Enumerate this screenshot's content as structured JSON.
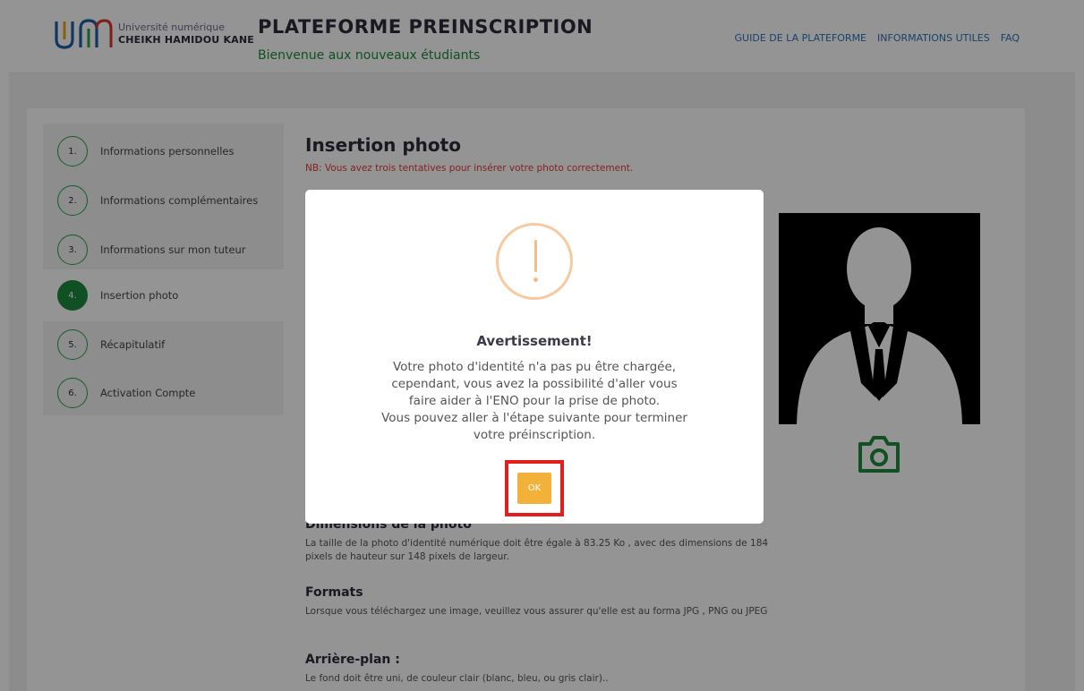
{
  "header": {
    "logo_line1": "Université numérique",
    "logo_line2": "CHEIKH HAMIDOU KANE",
    "title": "PLATEFORME PREINSCRIPTION",
    "subtitle": "Bienvenue aux nouveaux étudiants",
    "nav": [
      "GUIDE DE LA PLATEFORME",
      "INFORMATIONS UTILES",
      "FAQ"
    ]
  },
  "steps": [
    {
      "num": "1.",
      "label": "Informations personnelles"
    },
    {
      "num": "2.",
      "label": "Informations complémentaires"
    },
    {
      "num": "3.",
      "label": "Informations sur mon tuteur"
    },
    {
      "num": "4.",
      "label": "Insertion photo",
      "active": true
    },
    {
      "num": "5.",
      "label": "Récapitulatif"
    },
    {
      "num": "6.",
      "label": "Activation Compte"
    }
  ],
  "main": {
    "title": "Insertion photo",
    "nb": "NB: Vous avez trois tentatives pour insérer votre photo correctement."
  },
  "sections": {
    "dimensions": {
      "title": "Dimensions de la photo",
      "text": "La taille de la photo d'identité numérique doit être égale à 83.25 Ko , avec des dimensions de 184 pixels de hauteur sur 148 pixels de largeur."
    },
    "formats": {
      "title": "Formats",
      "text": "Lorsque vous téléchargez une image, veuillez vous assurer qu'elle est au forma JPG , PNG ou JPEG"
    },
    "background": {
      "title": "Arrière-plan :",
      "text": "Le fond doit être uni, de couleur clair (blanc, bleu, ou gris clair).."
    }
  },
  "modal": {
    "title": "Avertissement!",
    "lines": [
      "Votre photo d'identité n'a pas pu être chargée,",
      "cependant, vous avez la possibilité d'aller vous",
      "faire aider à l'ENO pour la prise de photo.",
      "Vous pouvez aller à l'étape suivante pour terminer",
      "votre préinscription."
    ],
    "ok_label": "OK"
  },
  "colors": {
    "brand_green": "#1c8a3d",
    "link_blue": "#2f6fb5",
    "warning_orange": "#f8bb86",
    "ok_button": "#f2b23a",
    "highlight_red": "#e11d1d",
    "nb_red": "#e53935"
  }
}
